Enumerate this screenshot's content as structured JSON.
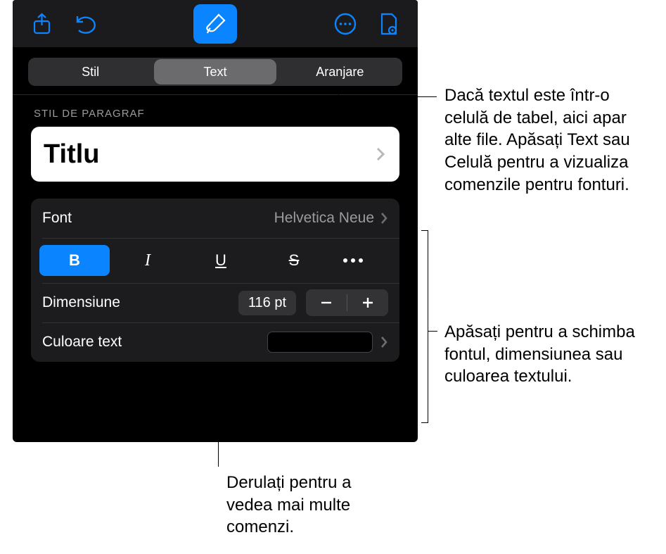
{
  "toolbar": {
    "share_icon": "share-icon",
    "undo_icon": "undo-icon",
    "brush_icon": "brush-icon",
    "more_icon": "more-icon",
    "inspect_icon": "inspect-icon"
  },
  "tabs": {
    "style": "Stil",
    "text": "Text",
    "arrange": "Aranjare"
  },
  "paragraph_section_label": "STIL DE PARAGRAF",
  "paragraph_style": "Titlu",
  "font_row": {
    "label": "Font",
    "value": "Helvetica Neue"
  },
  "format_buttons": {
    "bold": "B",
    "italic": "I",
    "underline": "U",
    "strike": "S"
  },
  "size_row": {
    "label": "Dimensiune",
    "value": "116 pt"
  },
  "color_row": {
    "label": "Culoare text"
  },
  "callouts": {
    "tabs": "Dacă textul este într‑o celulă de tabel, aici apar alte file. Apăsați Text sau Celulă pentru a vizualiza comenzile pentru fonturi.",
    "font_group": "Apăsați pentru a schimba fontul, dimensiunea sau culoarea textului.",
    "scroll": "Derulați pentru a vedea mai multe comenzi."
  }
}
